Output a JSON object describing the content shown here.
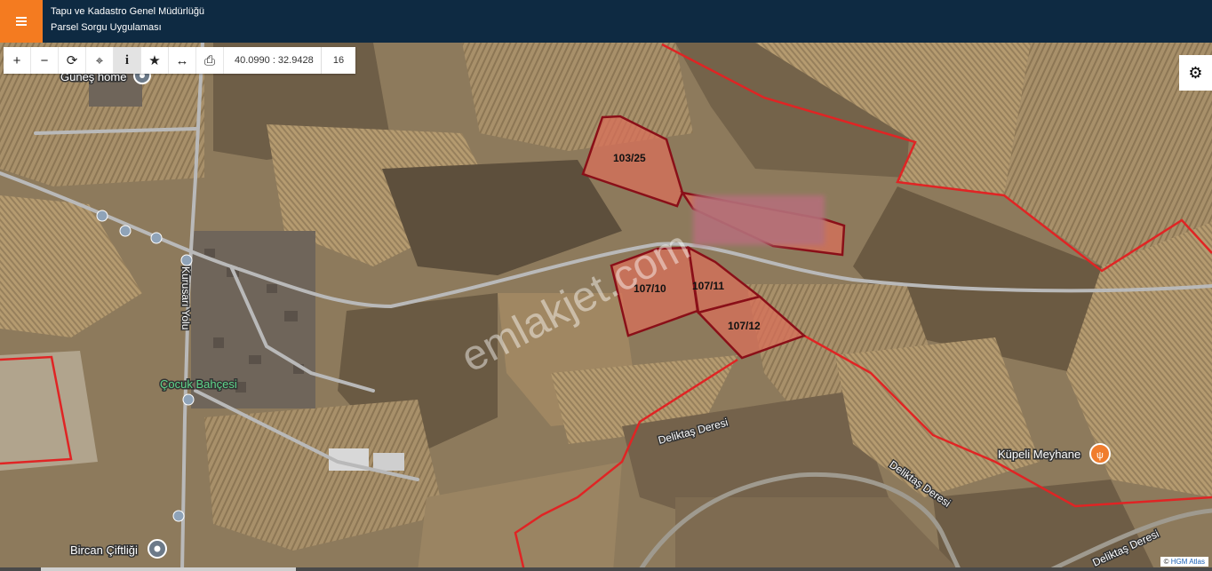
{
  "header": {
    "line1": "Tapu ve Kadastro Genel Müdürlüğü",
    "line2": "Parsel Sorgu Uygulaması",
    "menu_icon": "hamburger-icon",
    "accent_color": "#f47b20",
    "bar_color": "#0e2a42"
  },
  "toolbar": {
    "tools": [
      {
        "icon": "zoom-in-icon",
        "glyph": "+"
      },
      {
        "icon": "zoom-out-icon",
        "glyph": "−"
      },
      {
        "icon": "refresh-icon",
        "glyph": "⟳"
      },
      {
        "icon": "locate-icon",
        "glyph": "⌖"
      },
      {
        "icon": "info-icon",
        "glyph": "i"
      },
      {
        "icon": "favorite-star-icon",
        "glyph": "★"
      },
      {
        "icon": "measure-icon",
        "glyph": "↔"
      },
      {
        "icon": "print-icon",
        "glyph": "⎙"
      }
    ],
    "coordinates": "40.0990 : 32.9428",
    "zoom_level": "16"
  },
  "settings_icon": "gear-icon",
  "parcels": [
    {
      "label": "103/25"
    },
    {
      "label": "107/10"
    },
    {
      "label": "107/11"
    },
    {
      "label": "107/12"
    }
  ],
  "places": [
    {
      "name": "Güneş home"
    },
    {
      "name": "Çocuk Bahçesi"
    },
    {
      "name": "Bircan Çiftliği"
    },
    {
      "name": "Küpeli Meyhane"
    }
  ],
  "roads": {
    "kurusari": "Kurusarı Yolu",
    "deliktas1": "Deliktaş Deresi",
    "deliktas2": "Deliktaş Deresi",
    "deliktas3": "Deliktaş Deresi"
  },
  "watermark": "emlakjet.com",
  "attribution": "HGM Atlas",
  "colors": {
    "parcel_fill": "#d9705a",
    "parcel_border": "#8a0f18",
    "boundary": "#e02424",
    "road": "#b9b9b9"
  }
}
